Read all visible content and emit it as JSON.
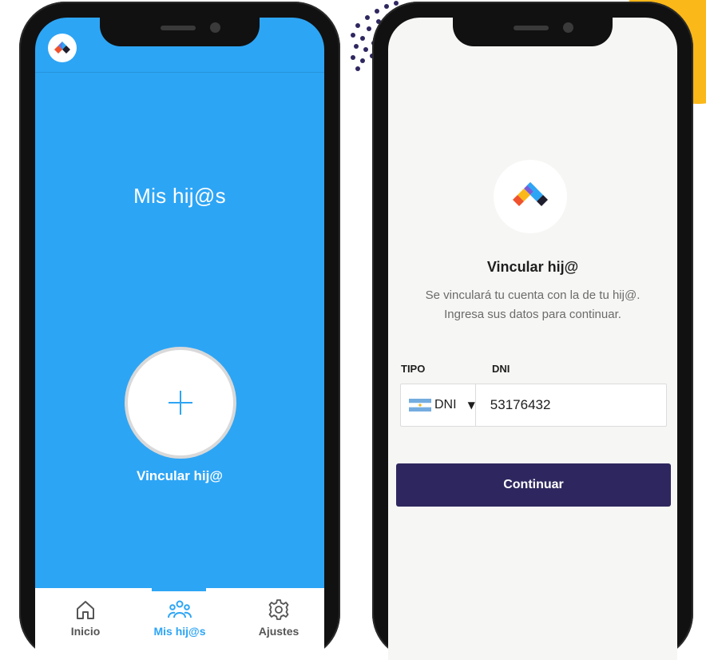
{
  "colors": {
    "primary_blue": "#2da5f5",
    "button_dark": "#2e275f",
    "accent_yellow": "#fbb819",
    "dots": "#2e275f"
  },
  "left_screen": {
    "logo_icon": "app-logo-icon",
    "title": "Mis hij@s",
    "add_icon": "plus-icon",
    "add_label": "Vincular hij@",
    "tabs": [
      {
        "icon": "home-icon",
        "label": "Inicio",
        "active": false
      },
      {
        "icon": "people-icon",
        "label": "Mis hij@s",
        "active": true
      },
      {
        "icon": "gear-icon",
        "label": "Ajustes",
        "active": false
      }
    ]
  },
  "right_screen": {
    "logo_icon": "app-logo-icon",
    "title": "Vincular hij@",
    "description_line1": "Se vinculará tu cuenta con la de tu hij@.",
    "description_line2": "Ingresa sus datos para continuar.",
    "type_label": "TIPO",
    "number_label": "DNI",
    "type_flag": "argentina-flag-icon",
    "type_value": "DNI",
    "number_value": "53176432",
    "continue_label": "Continuar"
  }
}
